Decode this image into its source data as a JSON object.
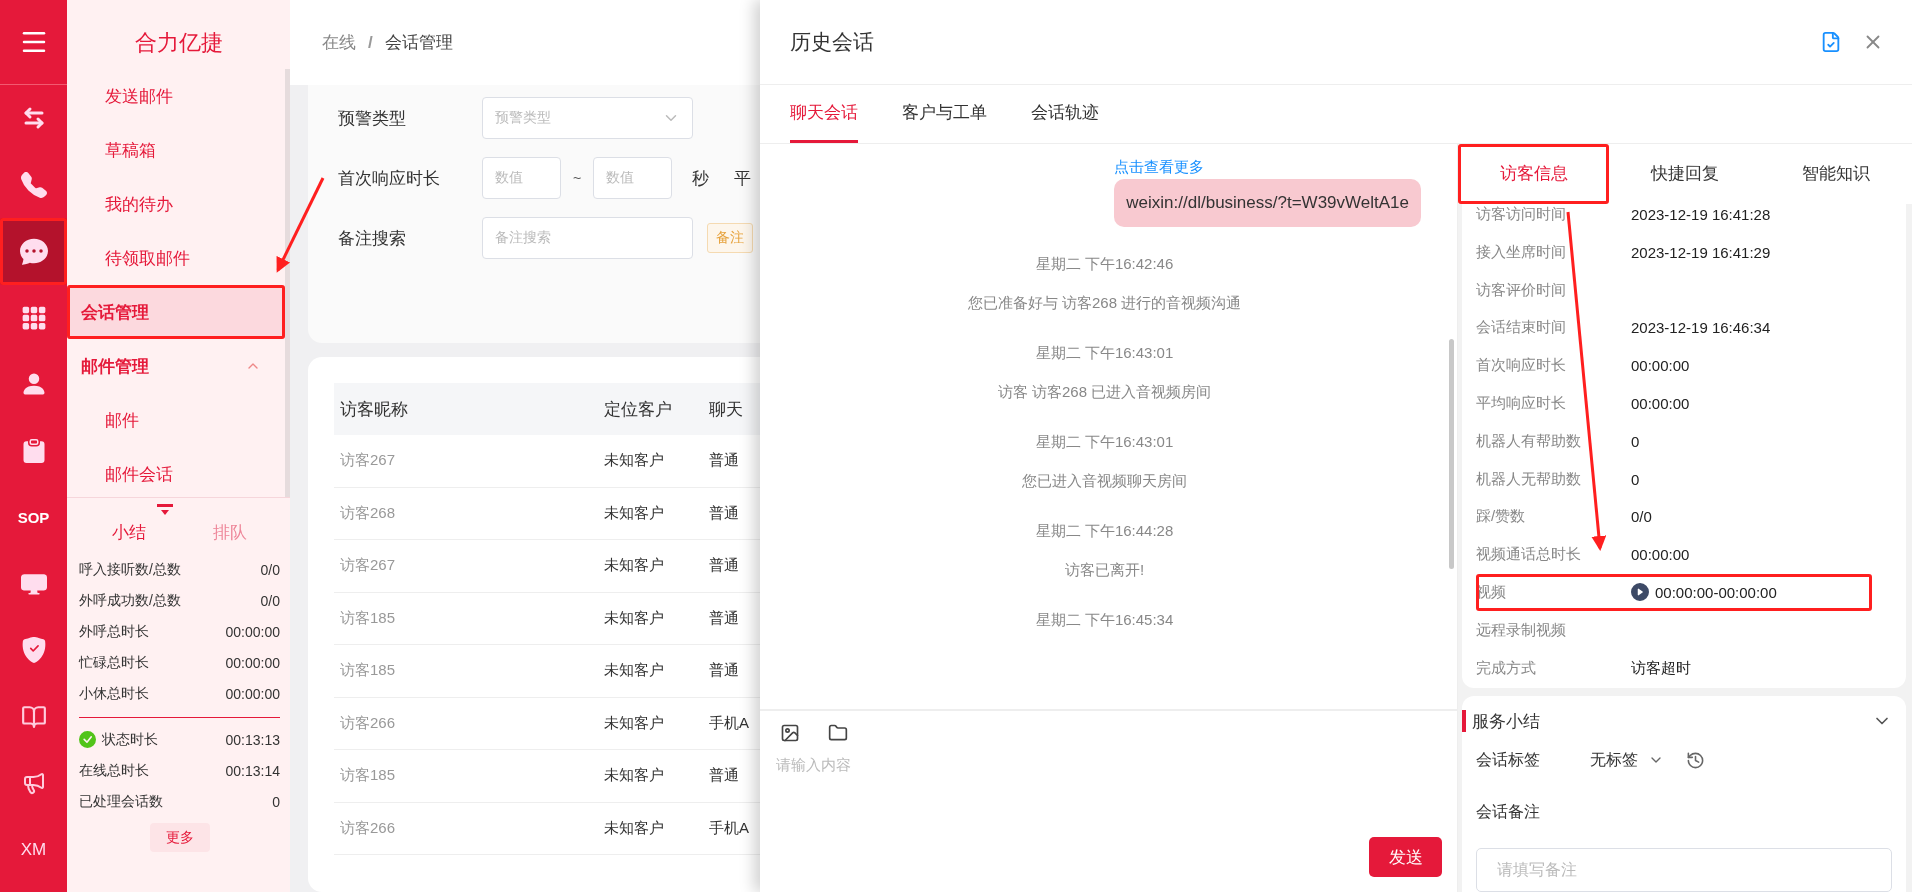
{
  "rail": {
    "items": [
      {
        "kind": "icon",
        "selected": false,
        "highlighted": false
      },
      {
        "kind": "icon",
        "selected": false,
        "highlighted": false
      },
      {
        "kind": "icon",
        "selected": true,
        "highlighted": true
      },
      {
        "kind": "icon",
        "selected": false,
        "highlighted": false
      },
      {
        "kind": "icon",
        "selected": false,
        "highlighted": false
      },
      {
        "kind": "icon",
        "selected": false,
        "highlighted": false
      },
      {
        "kind": "text",
        "label": "SOP",
        "selected": false,
        "highlighted": false
      },
      {
        "kind": "icon",
        "selected": false,
        "highlighted": false
      },
      {
        "kind": "icon",
        "selected": false,
        "highlighted": false
      },
      {
        "kind": "icon",
        "selected": false,
        "highlighted": false
      },
      {
        "kind": "icon",
        "selected": false,
        "highlighted": false
      },
      {
        "kind": "text",
        "label": "XM",
        "selected": false,
        "highlighted": false
      }
    ]
  },
  "sidebar": {
    "title": "合力亿捷",
    "items": [
      {
        "kind": "sub",
        "label": "发送邮件",
        "selected": false,
        "highlighted": false
      },
      {
        "kind": "sub",
        "label": "草稿箱",
        "selected": false,
        "highlighted": false
      },
      {
        "kind": "sub",
        "label": "我的待办",
        "selected": false,
        "highlighted": false
      },
      {
        "kind": "sub",
        "label": "待领取邮件",
        "selected": false,
        "highlighted": false
      },
      {
        "kind": "top",
        "label": "会话管理",
        "selected": true,
        "highlighted": true
      },
      {
        "kind": "group",
        "label": "邮件管理",
        "selected": false,
        "highlighted": false,
        "expanded": true,
        "children": [
          {
            "kind": "sub",
            "label": "邮件",
            "selected": false,
            "highlighted": false
          },
          {
            "kind": "sub",
            "label": "邮件会话",
            "selected": false,
            "highlighted": false
          }
        ]
      }
    ],
    "summary_tabs": [
      {
        "label": "小结",
        "selected": true
      },
      {
        "label": "排队",
        "selected": false
      }
    ],
    "stats": [
      {
        "label": "呼入接听数/总数",
        "value": "0/0"
      },
      {
        "label": "外呼成功数/总数",
        "value": "0/0"
      },
      {
        "label": "外呼总时长",
        "value": "00:00:00"
      },
      {
        "label": "忙碌总时长",
        "value": "00:00:00"
      },
      {
        "label": "小休总时长",
        "value": "00:00:00"
      }
    ],
    "status": [
      {
        "kind": "status",
        "label": "状态时长",
        "value": "00:13:13"
      },
      {
        "kind": "plain",
        "label": "在线总时长",
        "value": "00:13:14"
      },
      {
        "kind": "plain",
        "label": "已处理会话数",
        "value": "0"
      }
    ],
    "more_button": "更多"
  },
  "breadcrumb": [
    "在线",
    "/",
    "会话管理"
  ],
  "filters": [
    {
      "kind": "select",
      "label": "预警类型",
      "placeholder": "预警类型"
    },
    {
      "kind": "range",
      "label": "首次响应时长",
      "placeholders": [
        "数值",
        "数值"
      ],
      "separator": "~",
      "unit": "秒",
      "next_label": "平"
    },
    {
      "kind": "text",
      "label": "备注搜索",
      "placeholder": "备注搜索",
      "tag": "备注"
    }
  ],
  "table": {
    "columns": [
      "访客昵称",
      "定位客户",
      "聊天"
    ],
    "rows": [
      [
        "访客267",
        "未知客户",
        "普通"
      ],
      [
        "访客268",
        "未知客户",
        "普通"
      ],
      [
        "访客267",
        "未知客户",
        "普通"
      ],
      [
        "访客185",
        "未知客户",
        "普通"
      ],
      [
        "访客185",
        "未知客户",
        "普通"
      ],
      [
        "访客266",
        "未知客户",
        "手机A"
      ],
      [
        "访客185",
        "未知客户",
        "普通"
      ],
      [
        "访客266",
        "未知客户",
        "手机A"
      ]
    ]
  },
  "drawer": {
    "title": "历史会话",
    "tabs": [
      {
        "label": "聊天会话",
        "selected": true
      },
      {
        "label": "客户与工单",
        "selected": false
      },
      {
        "label": "会话轨迹",
        "selected": false
      }
    ],
    "load_more": "点击查看更多",
    "messages": [
      {
        "kind": "bubble",
        "text": "weixin://dl/business/?t=W39vWeltA1e"
      },
      {
        "kind": "time",
        "text": "星期二 下午16:42:46"
      },
      {
        "kind": "system",
        "text": "您已准备好与 访客268 进行的音视频沟通"
      },
      {
        "kind": "time",
        "text": "星期二 下午16:43:01"
      },
      {
        "kind": "system",
        "text": "访客 访客268 已进入音视频房间"
      },
      {
        "kind": "time",
        "text": "星期二 下午16:43:01"
      },
      {
        "kind": "system",
        "text": "您已进入音视频聊天房间"
      },
      {
        "kind": "time",
        "text": "星期二 下午16:44:28"
      },
      {
        "kind": "system",
        "text": "访客已离开!"
      },
      {
        "kind": "time",
        "text": "星期二 下午16:45:34"
      }
    ],
    "input_placeholder": "请输入内容",
    "send_button": "发送",
    "side_tabs": [
      {
        "label": "访客信息",
        "selected": true,
        "highlighted": true
      },
      {
        "label": "快捷回复",
        "selected": false,
        "highlighted": false
      },
      {
        "label": "智能知识",
        "selected": false,
        "highlighted": false
      }
    ],
    "info": [
      {
        "kind": "text",
        "label": "访客访问时间",
        "value": "2023-12-19 16:41:28",
        "highlighted": false
      },
      {
        "kind": "text",
        "label": "接入坐席时间",
        "value": "2023-12-19 16:41:29",
        "highlighted": false
      },
      {
        "kind": "text",
        "label": "访客评价时间",
        "highlighted": false
      },
      {
        "kind": "text",
        "label": "会话结束时间",
        "value": "2023-12-19 16:46:34",
        "highlighted": false
      },
      {
        "kind": "text",
        "label": "首次响应时长",
        "value": "00:00:00",
        "highlighted": false
      },
      {
        "kind": "text",
        "label": "平均响应时长",
        "value": "00:00:00",
        "highlighted": false
      },
      {
        "kind": "text",
        "label": "机器人有帮助数",
        "value": "0",
        "highlighted": false
      },
      {
        "kind": "text",
        "label": "机器人无帮助数",
        "value": "0",
        "highlighted": false
      },
      {
        "kind": "text",
        "label": "踩/赞数",
        "value": "0/0",
        "highlighted": false
      },
      {
        "kind": "text",
        "label": "视频通话总时长",
        "value": "00:00:00",
        "highlighted": false
      },
      {
        "kind": "video",
        "label": "视频",
        "value": "00:00:00-00:00:00",
        "highlighted": true
      },
      {
        "kind": "text",
        "label": "远程录制视频",
        "highlighted": false
      },
      {
        "kind": "text",
        "label": "完成方式",
        "value": "访客超时",
        "highlighted": false
      }
    ],
    "service": {
      "title": "服务小结",
      "tag_label": "会话标签",
      "tag_value": "无标签",
      "note_label": "会话备注",
      "note_placeholder": "请填写备注"
    }
  }
}
